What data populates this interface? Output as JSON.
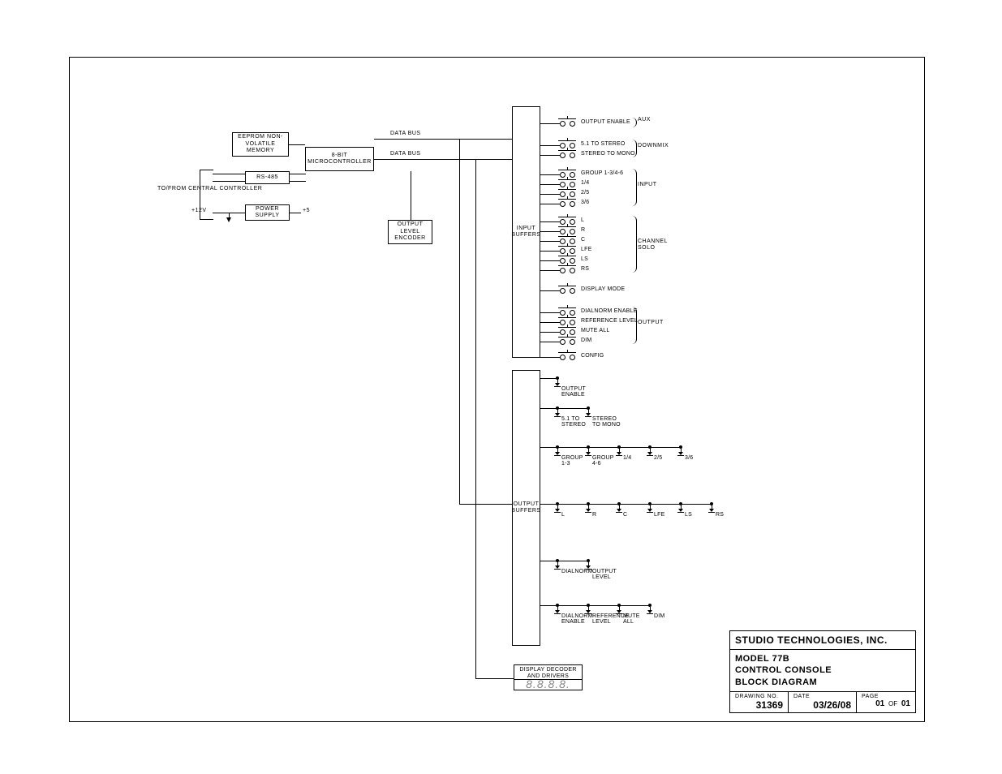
{
  "doc_id": "M77BBD_A",
  "blocks": {
    "eeprom": "EEPROM\nNON-VOLATILE\nMEMORY",
    "mcu": "8-BIT\nMICROCONTROLLER",
    "rs485": "RS-485",
    "psu": "POWER\nSUPPLY",
    "encoder": "OUTPUT\nLEVEL\nENCODER",
    "in_buf": "INPUT\nBUFFERS",
    "out_buf": "OUTPUT\nBUFFERS",
    "disp_dec": "DISPLAY DECODER\nAND DRIVERS",
    "seven_seg": "8.8.8.8."
  },
  "wire_labels": {
    "data_bus": "DATA BUS",
    "tofrom": "TO/FROM\nCENTRAL\nCONTROLLER",
    "v12": "+12V",
    "v5": "+5"
  },
  "switches": {
    "aux": [
      {
        "lbl": "OUTPUT ENABLE"
      }
    ],
    "downmix": [
      {
        "lbl": "5.1 TO STEREO"
      },
      {
        "lbl": "STEREO TO MONO"
      }
    ],
    "input": [
      {
        "lbl": "GROUP 1-3/4-6"
      },
      {
        "lbl": "1/4"
      },
      {
        "lbl": "2/5"
      },
      {
        "lbl": "3/6"
      }
    ],
    "solo": [
      {
        "lbl": "L"
      },
      {
        "lbl": "R"
      },
      {
        "lbl": "C"
      },
      {
        "lbl": "LFE"
      },
      {
        "lbl": "LS"
      },
      {
        "lbl": "RS"
      }
    ],
    "display": [
      {
        "lbl": "DISPLAY MODE"
      }
    ],
    "output": [
      {
        "lbl": "DIALNORM ENABLE"
      },
      {
        "lbl": "REFERENCE LEVEL"
      },
      {
        "lbl": "MUTE ALL"
      },
      {
        "lbl": "DIM"
      }
    ],
    "config": [
      {
        "lbl": "CONFIG"
      }
    ]
  },
  "sw_groups": {
    "aux": "AUX",
    "downmix": "DOWNMIX",
    "input": "INPUT",
    "solo": "CHANNEL\nSOLO",
    "output": "OUTPUT"
  },
  "leds": {
    "row1": [
      {
        "lbl": "OUTPUT\nENABLE"
      }
    ],
    "row2": [
      {
        "lbl": "5.1 TO\nSTEREO"
      },
      {
        "lbl": "STEREO\nTO MONO"
      }
    ],
    "row3": [
      {
        "lbl": "GROUP\n1-3"
      },
      {
        "lbl": "GROUP\n4-6"
      },
      {
        "lbl": "1/4"
      },
      {
        "lbl": "2/5"
      },
      {
        "lbl": "3/6"
      }
    ],
    "row4": [
      {
        "lbl": "L"
      },
      {
        "lbl": "R"
      },
      {
        "lbl": "C"
      },
      {
        "lbl": "LFE"
      },
      {
        "lbl": "LS"
      },
      {
        "lbl": "RS"
      }
    ],
    "row5": [
      {
        "lbl": "DIALNORM"
      },
      {
        "lbl": "OUTPUT\nLEVEL"
      }
    ],
    "row6": [
      {
        "lbl": "DIALNORM\nENABLE"
      },
      {
        "lbl": "REFERENCE\nLEVEL"
      },
      {
        "lbl": "MUTE\nALL"
      },
      {
        "lbl": "DIM"
      }
    ]
  },
  "title_block": {
    "company": "STUDIO TECHNOLOGIES, INC.",
    "title": "MODEL 77B\nCONTROL CONSOLE\nBLOCK DIAGRAM",
    "drawing_no_k": "DRAWING NO.",
    "drawing_no_v": "31369",
    "date_k": "DATE",
    "date_v": "03/26/08",
    "page_k": "PAGE",
    "page_cur": "01",
    "page_of": "OF",
    "page_tot": "01"
  }
}
